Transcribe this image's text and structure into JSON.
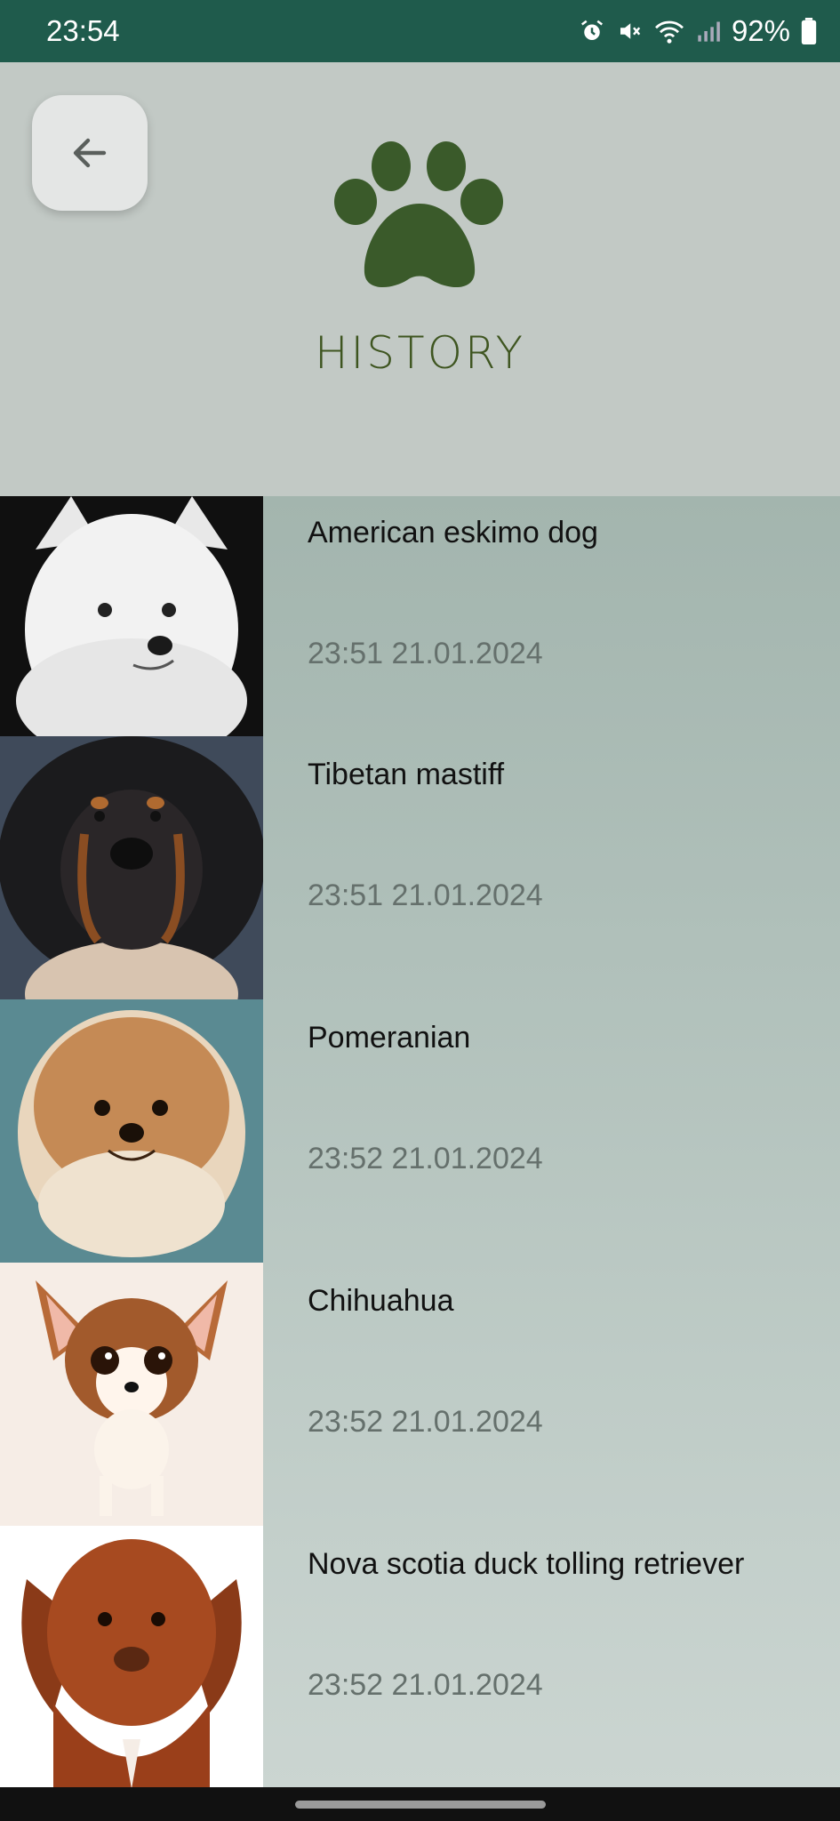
{
  "status_bar": {
    "time": "23:54",
    "battery": "92%",
    "icons": [
      "alarm-icon",
      "mute-icon",
      "wifi-icon",
      "signal-icon",
      "battery-icon"
    ]
  },
  "header": {
    "back_icon": "arrow-left-icon",
    "logo_icon": "paw-icon",
    "title": "HISTORY"
  },
  "history": [
    {
      "breed": "American eskimo dog",
      "datetime": "23:51 21.01.2024"
    },
    {
      "breed": "Tibetan mastiff",
      "datetime": "23:51 21.01.2024"
    },
    {
      "breed": "Pomeranian",
      "datetime": "23:52 21.01.2024"
    },
    {
      "breed": "Chihuahua",
      "datetime": "23:52 21.01.2024"
    },
    {
      "breed": "Nova scotia duck tolling retriever",
      "datetime": "23:52 21.01.2024"
    }
  ],
  "colors": {
    "status_bar": "#1f5b4c",
    "accent": "#3e5520",
    "paw": "#3a5a2a"
  }
}
